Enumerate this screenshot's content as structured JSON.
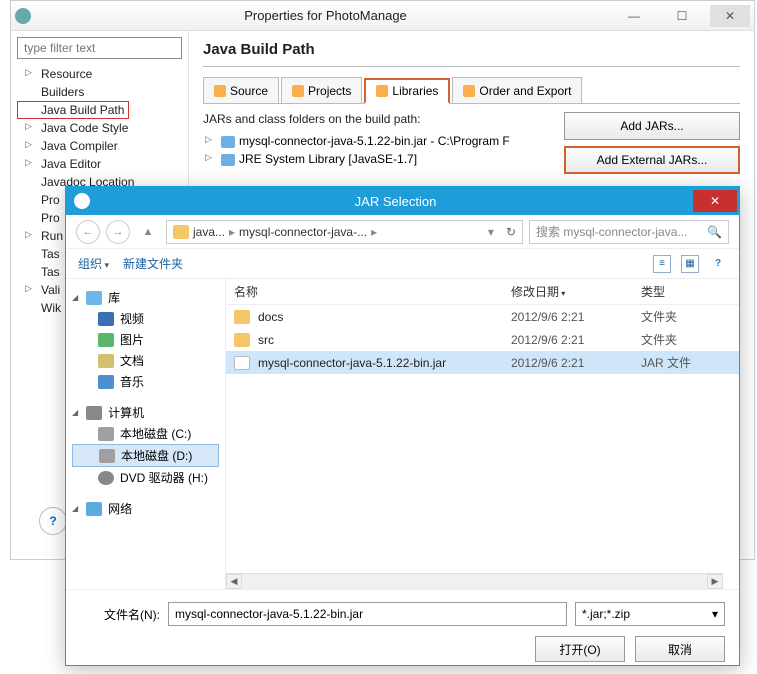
{
  "props": {
    "title": "Properties for PhotoManage",
    "filter_placeholder": "type filter text",
    "tree": {
      "resource": "Resource",
      "builders": "Builders",
      "jbp": "Java Build Path",
      "jcs": "Java Code Style",
      "jc": "Java Compiler",
      "je": "Java Editor",
      "jloc": "Javadoc Location",
      "pro1": "Pro",
      "pro2": "Pro",
      "run": "Run",
      "tas1": "Tas",
      "tas2": "Tas",
      "vali": "Vali",
      "wik": "Wik"
    },
    "heading": "Java Build Path",
    "tabs": {
      "source": "Source",
      "projects": "Projects",
      "libraries": "Libraries",
      "order": "Order and Export"
    },
    "bp_label": "JARs and class folders on the build path:",
    "bp_rows": {
      "r0": "mysql-connector-java-5.1.22-bin.jar - C:\\Program F",
      "r1": "JRE System Library [JavaSE-1.7]"
    },
    "buttons": {
      "add_jars": "Add JARs...",
      "add_ext": "Add External JARs..."
    }
  },
  "jar": {
    "title": "JAR Selection",
    "bc": {
      "p1": "java...",
      "p2": "mysql-connector-java-..."
    },
    "search_placeholder": "搜索 mysql-connector-java...",
    "toolbar": {
      "org": "组织",
      "new_folder": "新建文件夹"
    },
    "side": {
      "lib": "库",
      "vid": "视频",
      "img": "图片",
      "doc": "文档",
      "mus": "音乐",
      "computer": "计算机",
      "c": "本地磁盘 (C:)",
      "d": "本地磁盘 (D:)",
      "dvd": "DVD 驱动器 (H:)",
      "net": "网络"
    },
    "cols": {
      "name": "名称",
      "date": "修改日期",
      "type": "类型"
    },
    "rows": {
      "r0": {
        "n": "docs",
        "d": "2012/9/6 2:21",
        "t": "文件夹"
      },
      "r1": {
        "n": "src",
        "d": "2012/9/6 2:21",
        "t": "文件夹"
      },
      "r2": {
        "n": "mysql-connector-java-5.1.22-bin.jar",
        "d": "2012/9/6 2:21",
        "t": "JAR 文件"
      }
    },
    "fn_label": "文件名(N):",
    "fn_value": "mysql-connector-java-5.1.22-bin.jar",
    "filter": "*.jar;*.zip",
    "open": "打开(O)",
    "cancel": "取消"
  }
}
